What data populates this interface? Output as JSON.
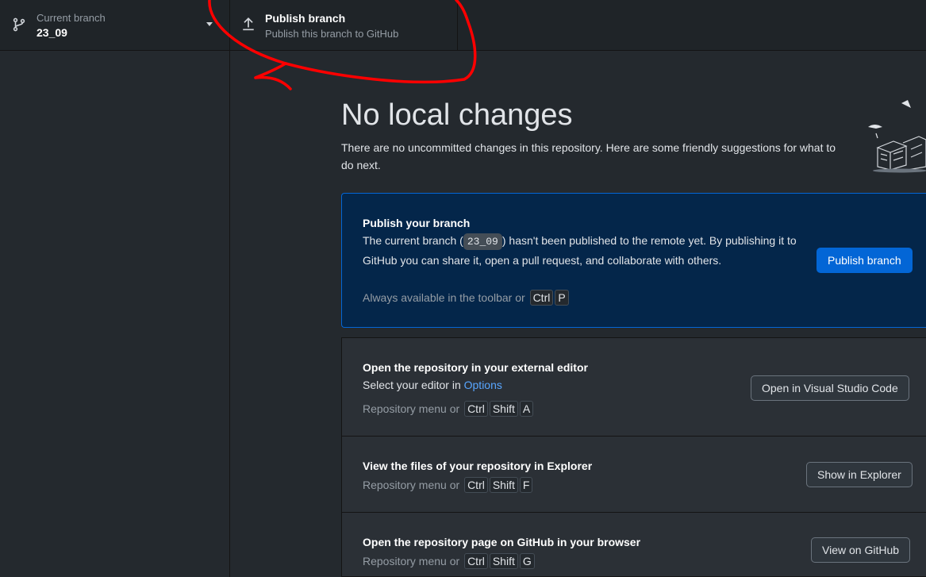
{
  "toolbar": {
    "branch": {
      "label": "Current branch",
      "value": "23_09",
      "icon": "git-branch-icon"
    },
    "publish": {
      "label": "Publish branch",
      "sublabel": "Publish this branch to GitHub",
      "icon": "upload-arrow-icon"
    }
  },
  "main": {
    "title": "No local changes",
    "subtitle": "There are no uncommitted changes in this repository. Here are some friendly suggestions for what to do next."
  },
  "cards": {
    "publish": {
      "title": "Publish your branch",
      "desc_pre": "The current branch (",
      "branch": "23_09",
      "desc_post": ") hasn't been published to the remote yet. By publishing it to GitHub you can share it, open a pull request, and collaborate with others.",
      "hint": "Always available in the toolbar or",
      "keys": [
        "Ctrl",
        "P"
      ],
      "button": "Publish branch"
    },
    "editor": {
      "title": "Open the repository in your external editor",
      "desc": "Select your editor in",
      "link": "Options",
      "hint": "Repository menu or",
      "keys": [
        "Ctrl",
        "Shift",
        "A"
      ],
      "button": "Open in Visual Studio Code"
    },
    "explorer": {
      "title": "View the files of your repository in Explorer",
      "hint": "Repository menu or",
      "keys": [
        "Ctrl",
        "Shift",
        "F"
      ],
      "button": "Show in Explorer"
    },
    "github": {
      "title": "Open the repository page on GitHub in your browser",
      "hint": "Repository menu or",
      "keys": [
        "Ctrl",
        "Shift",
        "G"
      ],
      "button": "View on GitHub"
    }
  },
  "colors": {
    "accent": "#0366d6",
    "annotation": "#ff0000",
    "background": "#24292e"
  }
}
